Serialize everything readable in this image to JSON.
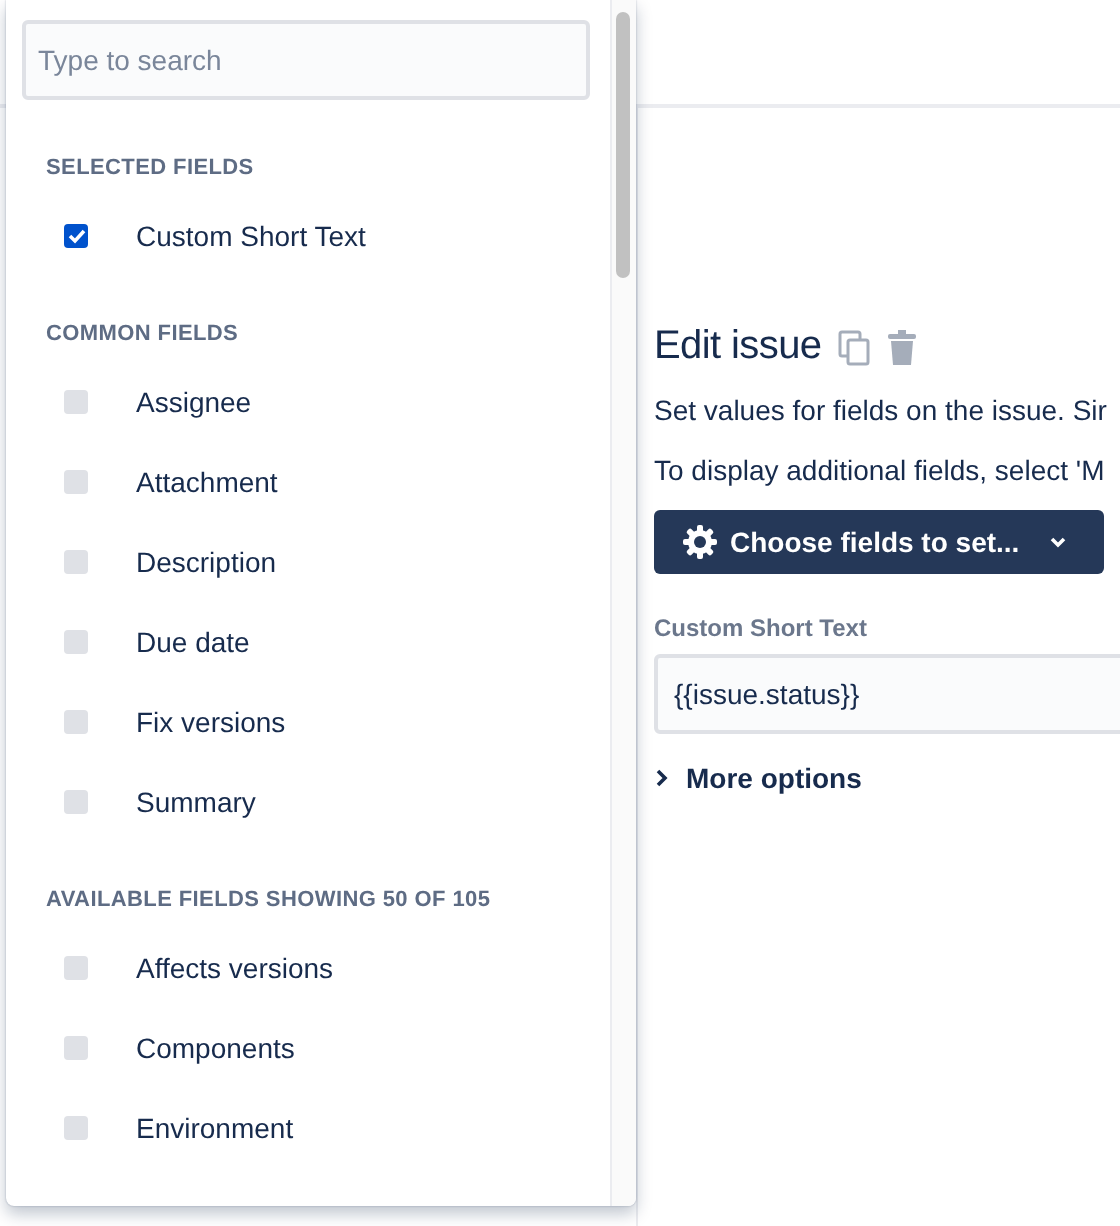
{
  "search": {
    "placeholder": "Type to search"
  },
  "sections": [
    {
      "heading": "SELECTED FIELDS",
      "items": [
        {
          "label": "Custom Short Text",
          "checked": true
        }
      ]
    },
    {
      "heading": "COMMON FIELDS",
      "items": [
        {
          "label": "Assignee",
          "checked": false
        },
        {
          "label": "Attachment",
          "checked": false
        },
        {
          "label": "Description",
          "checked": false
        },
        {
          "label": "Due date",
          "checked": false
        },
        {
          "label": "Fix versions",
          "checked": false
        },
        {
          "label": "Summary",
          "checked": false
        }
      ]
    },
    {
      "heading": "AVAILABLE FIELDS SHOWING 50 OF 105",
      "items": [
        {
          "label": "Affects versions",
          "checked": false
        },
        {
          "label": "Components",
          "checked": false
        },
        {
          "label": "Environment",
          "checked": false
        }
      ]
    }
  ],
  "panel": {
    "title": "Edit issue",
    "lines": [
      "Set values for fields on the issue. Sir",
      "To display additional fields, select 'M"
    ],
    "choose_button": "Choose fields to set...",
    "field": {
      "label": "Custom Short Text",
      "value": "{{issue.status}}"
    },
    "more_options": "More options"
  }
}
